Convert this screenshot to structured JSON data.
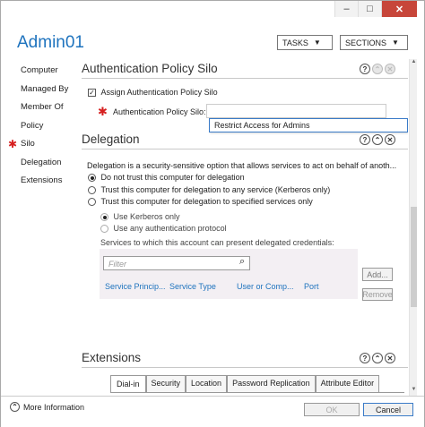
{
  "window": {
    "title": "Admin01",
    "titlebar_controls": [
      "–",
      "□",
      "✕"
    ],
    "tasks_label": "TASKS",
    "sections_label": "SECTIONS"
  },
  "sidebar": {
    "items": [
      {
        "label": "Computer"
      },
      {
        "label": "Managed By"
      },
      {
        "label": "Member Of"
      },
      {
        "label": "Policy"
      },
      {
        "label": "Silo",
        "marker": "✱"
      },
      {
        "label": "Delegation"
      },
      {
        "label": "Extensions"
      }
    ]
  },
  "silo_section": {
    "title": "Authentication Policy Silo",
    "assign_label": "Assign Authentication Policy Silo",
    "assign_checked": true,
    "required_marker": "✱",
    "field_label": "Authentication Policy Silo:",
    "field_value": "",
    "dropdown_option": "Restrict Access for Admins"
  },
  "delegation_section": {
    "title": "Delegation",
    "description": "Delegation is a security-sensitive option that allows services to act on behalf of anoth...",
    "options": [
      {
        "label": "Do not trust this computer for delegation",
        "selected": true
      },
      {
        "label": "Trust this computer for delegation to any service (Kerberos only)",
        "selected": false
      },
      {
        "label": "Trust this computer for delegation to specified services only",
        "selected": false
      }
    ],
    "sub_options": [
      {
        "label": "Use Kerberos only",
        "selected": true
      },
      {
        "label": "Use any authentication protocol",
        "selected": false
      }
    ],
    "services_label": "Services to which this account can present delegated credentials:",
    "filter_placeholder": "Filter",
    "columns": [
      "Service Princip...",
      "Service Type",
      "User or Comp...",
      "Port"
    ],
    "add_label": "Add...",
    "remove_label": "Remove"
  },
  "extensions_section": {
    "title": "Extensions",
    "tabs": [
      "Dial-in",
      "Security",
      "Location",
      "Password Replication",
      "Attribute Editor"
    ]
  },
  "footer": {
    "more_info": "More Information",
    "ok_label": "OK",
    "cancel_label": "Cancel"
  },
  "icons": {
    "help": "?",
    "collapse": "⌃",
    "close": "✕",
    "search": "⌕",
    "chevron_up": "⌃"
  },
  "colors": {
    "accent": "#1e73be",
    "required": "#d62020",
    "close_button": "#c7463a"
  }
}
